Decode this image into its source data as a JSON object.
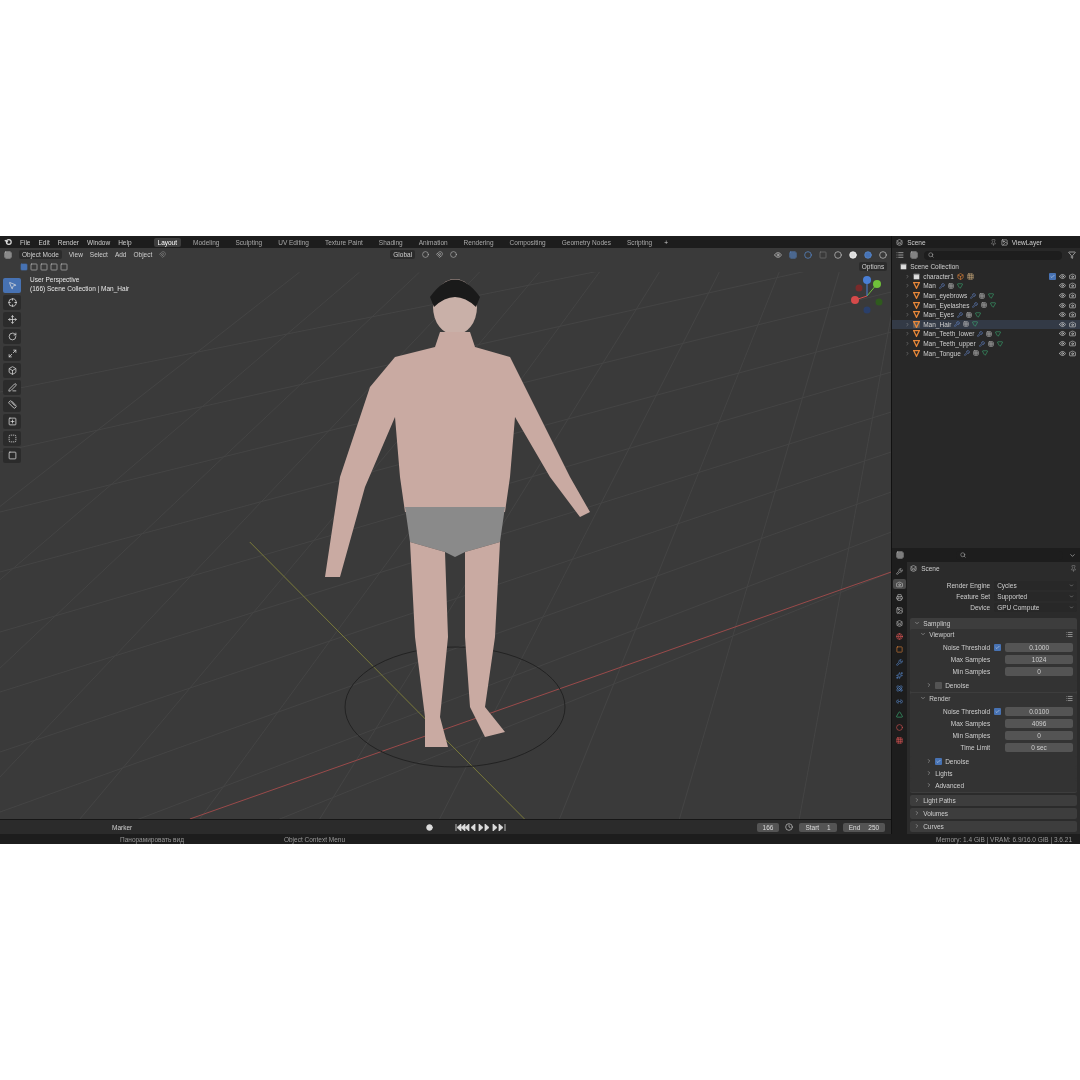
{
  "menu": [
    "File",
    "Edit",
    "Render",
    "Window",
    "Help"
  ],
  "workspaces": [
    {
      "label": "Layout",
      "selected": true
    },
    {
      "label": "Modeling",
      "selected": false
    },
    {
      "label": "Sculpting",
      "selected": false
    },
    {
      "label": "UV Editing",
      "selected": false
    },
    {
      "label": "Texture Paint",
      "selected": false
    },
    {
      "label": "Shading",
      "selected": false
    },
    {
      "label": "Animation",
      "selected": false
    },
    {
      "label": "Rendering",
      "selected": false
    },
    {
      "label": "Compositing",
      "selected": false
    },
    {
      "label": "Geometry Nodes",
      "selected": false
    },
    {
      "label": "Scripting",
      "selected": false
    }
  ],
  "add_workspace": "+",
  "viewport": {
    "mode": "Object Mode",
    "menus": [
      "View",
      "Select",
      "Add",
      "Object"
    ],
    "orientation": "Global",
    "options": "Options",
    "overlay_lines": [
      "User Perspective",
      "(166) Scene Collection | Man_Hair"
    ],
    "tools": [
      {
        "kind": "select",
        "selected": true
      },
      {
        "kind": "cursor",
        "selected": false
      },
      {
        "kind": "move",
        "selected": false
      },
      {
        "kind": "rotate",
        "selected": false
      },
      {
        "kind": "scale",
        "selected": false
      },
      {
        "kind": "transform",
        "selected": false
      },
      {
        "kind": "annotate",
        "selected": false
      },
      {
        "kind": "measure",
        "selected": false
      },
      {
        "kind": "add_cube",
        "selected": false
      },
      {
        "kind": "extrude",
        "selected": false
      },
      {
        "kind": "bevel",
        "selected": false
      }
    ]
  },
  "timeline": {
    "menus": [
      "Marker"
    ],
    "current_frame": "166",
    "start_label": "Start",
    "start": "1",
    "end_label": "End",
    "end": "250"
  },
  "outliner": {
    "scene": "Scene",
    "view_layer": "ViewLayer",
    "root": "Scene Collection",
    "items": [
      {
        "name": "character1",
        "kind": "collection",
        "selected": false
      },
      {
        "name": "Man",
        "kind": "mesh",
        "selected": false
      },
      {
        "name": "Man_eyebrows",
        "kind": "mesh",
        "selected": false
      },
      {
        "name": "Man_Eyelashes",
        "kind": "mesh",
        "selected": false
      },
      {
        "name": "Man_Eyes",
        "kind": "mesh",
        "selected": false
      },
      {
        "name": "Man_Hair",
        "kind": "mesh",
        "selected": true
      },
      {
        "name": "Man_Teeth_lower",
        "kind": "mesh",
        "selected": false
      },
      {
        "name": "Man_Teeth_upper",
        "kind": "mesh",
        "selected": false
      },
      {
        "name": "Man_Tongue",
        "kind": "mesh",
        "selected": false
      }
    ]
  },
  "properties": {
    "tabs": [
      {
        "kind": "tool",
        "selected": false
      },
      {
        "kind": "render",
        "selected": true
      },
      {
        "kind": "output",
        "selected": false
      },
      {
        "kind": "view_layer",
        "selected": false
      },
      {
        "kind": "scene",
        "selected": false
      },
      {
        "kind": "world",
        "selected": false
      },
      {
        "kind": "object",
        "selected": false
      },
      {
        "kind": "modifiers",
        "selected": false
      },
      {
        "kind": "particles",
        "selected": false
      },
      {
        "kind": "physics",
        "selected": false
      },
      {
        "kind": "constraints",
        "selected": false
      },
      {
        "kind": "data",
        "selected": false
      },
      {
        "kind": "material",
        "selected": false
      },
      {
        "kind": "texture",
        "selected": false
      }
    ],
    "context": "Scene",
    "fields": [
      {
        "label": "Render Engine",
        "value": "Cycles"
      },
      {
        "label": "Feature Set",
        "value": "Supported"
      },
      {
        "label": "Device",
        "value": "GPU Compute"
      }
    ],
    "panels": [
      {
        "title": "Sampling",
        "expanded": true,
        "children": [
          {
            "title": "Viewport",
            "expanded": true,
            "rows": [
              {
                "kind": "check_number",
                "label": "Noise Threshold",
                "checked": true,
                "value": "0.1000"
              },
              {
                "kind": "number",
                "label": "Max Samples",
                "value": "1024"
              },
              {
                "kind": "number",
                "label": "Min Samples",
                "value": "0"
              }
            ],
            "children": [
              {
                "title": "Denoise",
                "expanded": false,
                "checked": false
              }
            ]
          },
          {
            "title": "Render",
            "expanded": true,
            "rows": [
              {
                "kind": "check_number",
                "label": "Noise Threshold",
                "checked": true,
                "value": "0.0100"
              },
              {
                "kind": "number",
                "label": "Max Samples",
                "value": "4096"
              },
              {
                "kind": "number",
                "label": "Min Samples",
                "value": "0"
              },
              {
                "kind": "number",
                "label": "Time Limit",
                "value": "0 sec"
              }
            ],
            "children": [
              {
                "title": "Denoise",
                "expanded": false,
                "checked": true
              },
              {
                "title": "Lights",
                "expanded": false
              },
              {
                "title": "Advanced",
                "expanded": false
              }
            ]
          }
        ]
      },
      {
        "title": "Light Paths",
        "expanded": false
      },
      {
        "title": "Volumes",
        "expanded": false
      },
      {
        "title": "Curves",
        "expanded": false
      }
    ]
  },
  "status_bar": {
    "hints": [
      "Панорамировать вид",
      "Object Context Menu"
    ],
    "info": "Memory: 1.4 GiB | VRAM: 6.9/16.0 GiB | 3.6.21"
  }
}
